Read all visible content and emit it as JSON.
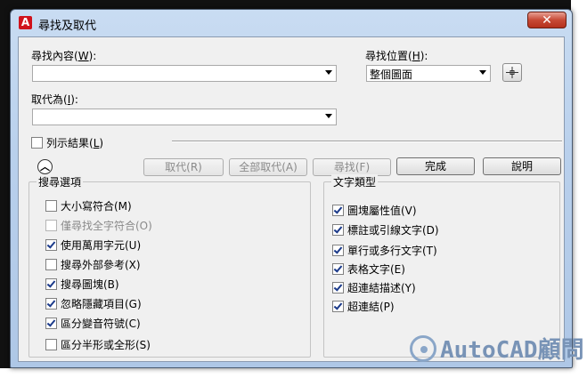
{
  "window": {
    "title": "尋找及取代",
    "app_logo": "A",
    "close_glyph": "✕"
  },
  "find_what": {
    "label": "尋找內容",
    "hotkey": "W",
    "value": ""
  },
  "find_where": {
    "label": "尋找位置",
    "hotkey": "H",
    "value": "整個圖面"
  },
  "replace_with": {
    "label": "取代為",
    "hotkey": "I",
    "value": ""
  },
  "list_results": {
    "label": "列示結果",
    "hotkey": "L",
    "checked": false
  },
  "buttons": {
    "replace": "取代(R)",
    "replace_all": "全部取代(A)",
    "find": "尋找(F)",
    "done": "完成",
    "help": "說明"
  },
  "search_options": {
    "title": "搜尋選項",
    "items": [
      {
        "label": "大小寫符合(M)",
        "checked": false,
        "enabled": true
      },
      {
        "label": "僅尋找全字符合(O)",
        "checked": false,
        "enabled": false
      },
      {
        "label": "使用萬用字元(U)",
        "checked": true,
        "enabled": true
      },
      {
        "label": "搜尋外部參考(X)",
        "checked": false,
        "enabled": true
      },
      {
        "label": "搜尋圖塊(B)",
        "checked": true,
        "enabled": true
      },
      {
        "label": "忽略隱藏項目(G)",
        "checked": true,
        "enabled": true
      },
      {
        "label": "區分變音符號(C)",
        "checked": true,
        "enabled": true
      },
      {
        "label": "區分半形或全形(S)",
        "checked": false,
        "enabled": true
      }
    ]
  },
  "text_types": {
    "title": "文字類型",
    "items": [
      {
        "label": "圖塊屬性值(V)",
        "checked": true
      },
      {
        "label": "標註或引線文字(D)",
        "checked": true
      },
      {
        "label": "單行或多行文字(T)",
        "checked": true
      },
      {
        "label": "表格文字(E)",
        "checked": true
      },
      {
        "label": "超連結描述(Y)",
        "checked": true
      },
      {
        "label": "超連結(P)",
        "checked": true
      }
    ]
  },
  "watermark": {
    "text": "AutoCAD顧問"
  }
}
